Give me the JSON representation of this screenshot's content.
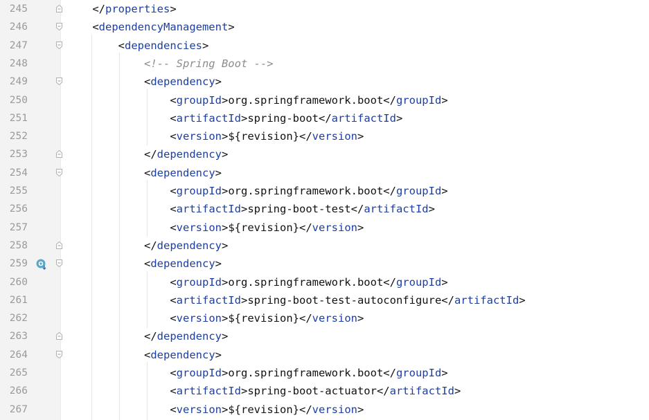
{
  "editor": {
    "lines": [
      {
        "num": "245",
        "indent": "    ",
        "open": "</",
        "tag": "properties",
        "close": ">",
        "text": "",
        "open2": "",
        "tag2": "",
        "close2": "",
        "fold": "end"
      },
      {
        "num": "246",
        "indent": "    ",
        "open": "<",
        "tag": "dependencyManagement",
        "close": ">",
        "text": "",
        "open2": "",
        "tag2": "",
        "close2": "",
        "fold": "start"
      },
      {
        "num": "247",
        "indent": "        ",
        "open": "<",
        "tag": "dependencies",
        "close": ">",
        "text": "",
        "open2": "",
        "tag2": "",
        "close2": "",
        "fold": "start"
      },
      {
        "num": "248",
        "indent": "            ",
        "comment": "<!-- Spring Boot -->",
        "fold": ""
      },
      {
        "num": "249",
        "indent": "            ",
        "open": "<",
        "tag": "dependency",
        "close": ">",
        "text": "",
        "open2": "",
        "tag2": "",
        "close2": "",
        "fold": "start"
      },
      {
        "num": "250",
        "indent": "                ",
        "open": "<",
        "tag": "groupId",
        "close": ">",
        "text": "org.springframework.boot",
        "open2": "</",
        "tag2": "groupId",
        "close2": ">",
        "fold": ""
      },
      {
        "num": "251",
        "indent": "                ",
        "open": "<",
        "tag": "artifactId",
        "close": ">",
        "text": "spring-boot",
        "open2": "</",
        "tag2": "artifactId",
        "close2": ">",
        "fold": ""
      },
      {
        "num": "252",
        "indent": "                ",
        "open": "<",
        "tag": "version",
        "close": ">",
        "text": "${revision}",
        "open2": "</",
        "tag2": "version",
        "close2": ">",
        "fold": ""
      },
      {
        "num": "253",
        "indent": "            ",
        "open": "</",
        "tag": "dependency",
        "close": ">",
        "text": "",
        "open2": "",
        "tag2": "",
        "close2": "",
        "fold": "end"
      },
      {
        "num": "254",
        "indent": "            ",
        "open": "<",
        "tag": "dependency",
        "close": ">",
        "text": "",
        "open2": "",
        "tag2": "",
        "close2": "",
        "fold": "start"
      },
      {
        "num": "255",
        "indent": "                ",
        "open": "<",
        "tag": "groupId",
        "close": ">",
        "text": "org.springframework.boot",
        "open2": "</",
        "tag2": "groupId",
        "close2": ">",
        "fold": ""
      },
      {
        "num": "256",
        "indent": "                ",
        "open": "<",
        "tag": "artifactId",
        "close": ">",
        "text": "spring-boot-test",
        "open2": "</",
        "tag2": "artifactId",
        "close2": ">",
        "fold": ""
      },
      {
        "num": "257",
        "indent": "                ",
        "open": "<",
        "tag": "version",
        "close": ">",
        "text": "${revision}",
        "open2": "</",
        "tag2": "version",
        "close2": ">",
        "fold": ""
      },
      {
        "num": "258",
        "indent": "            ",
        "open": "</",
        "tag": "dependency",
        "close": ">",
        "text": "",
        "open2": "",
        "tag2": "",
        "close2": "",
        "fold": "end"
      },
      {
        "num": "259",
        "indent": "            ",
        "open": "<",
        "tag": "dependency",
        "close": ">",
        "text": "",
        "open2": "",
        "tag2": "",
        "close2": "",
        "fold": "start",
        "bookmark": true
      },
      {
        "num": "260",
        "indent": "                ",
        "open": "<",
        "tag": "groupId",
        "close": ">",
        "text": "org.springframework.boot",
        "open2": "</",
        "tag2": "groupId",
        "close2": ">",
        "fold": ""
      },
      {
        "num": "261",
        "indent": "                ",
        "open": "<",
        "tag": "artifactId",
        "close": ">",
        "text": "spring-boot-test-autoconfigure",
        "open2": "</",
        "tag2": "artifactId",
        "close2": ">",
        "fold": ""
      },
      {
        "num": "262",
        "indent": "                ",
        "open": "<",
        "tag": "version",
        "close": ">",
        "text": "${revision}",
        "open2": "</",
        "tag2": "version",
        "close2": ">",
        "fold": ""
      },
      {
        "num": "263",
        "indent": "            ",
        "open": "</",
        "tag": "dependency",
        "close": ">",
        "text": "",
        "open2": "",
        "tag2": "",
        "close2": "",
        "fold": "end"
      },
      {
        "num": "264",
        "indent": "            ",
        "open": "<",
        "tag": "dependency",
        "close": ">",
        "text": "",
        "open2": "",
        "tag2": "",
        "close2": "",
        "fold": "start"
      },
      {
        "num": "265",
        "indent": "                ",
        "open": "<",
        "tag": "groupId",
        "close": ">",
        "text": "org.springframework.boot",
        "open2": "</",
        "tag2": "groupId",
        "close2": ">",
        "fold": ""
      },
      {
        "num": "266",
        "indent": "                ",
        "open": "<",
        "tag": "artifactId",
        "close": ">",
        "text": "spring-boot-actuator",
        "open2": "</",
        "tag2": "artifactId",
        "close2": ">",
        "fold": ""
      },
      {
        "num": "267",
        "indent": "                ",
        "open": "<",
        "tag": "version",
        "close": ">",
        "text": "${revision}",
        "open2": "</",
        "tag2": "version",
        "close2": ">",
        "fold": ""
      }
    ]
  },
  "colors": {
    "tag": "#1b3ea3",
    "text": "#111111",
    "comment": "#8c8c8c",
    "line_number": "#9a9a9a",
    "gutter": "#f3f3f3"
  },
  "icons": {
    "fold_start": "fold-start-icon",
    "fold_end": "fold-end-icon",
    "bookmark": "implementation-gutter-icon"
  }
}
